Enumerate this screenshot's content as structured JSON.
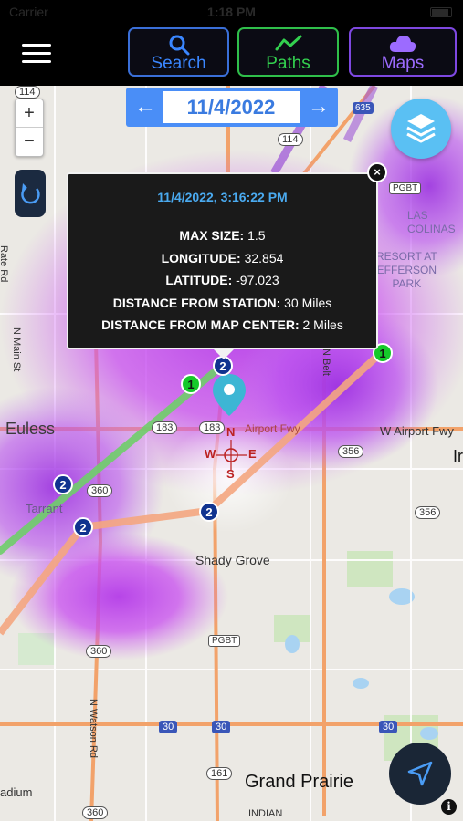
{
  "status": {
    "carrier": "Carrier",
    "time": "1:18 PM"
  },
  "header": {
    "menu_icon": "hamburger-menu-icon",
    "buttons": [
      {
        "label": "Search",
        "icon": "magnifier-icon",
        "color": "#3a86ff"
      },
      {
        "label": "Paths",
        "icon": "trend-line-icon",
        "color": "#33d14f"
      },
      {
        "label": "Maps",
        "icon": "cloud-icon",
        "color": "#9c6bff"
      }
    ]
  },
  "datebar": {
    "prev": "←",
    "date": "11/4/2022",
    "next": "→"
  },
  "zoom": {
    "in": "+",
    "out": "−"
  },
  "popup": {
    "title": "11/4/2022, 3:16:22 PM",
    "close": "×",
    "rows": [
      {
        "label": "MAX SIZE:",
        "value": "1.5"
      },
      {
        "label": "LONGITUDE:",
        "value": "32.854"
      },
      {
        "label": "LATITUDE:",
        "value": "-97.023"
      },
      {
        "label": "DISTANCE FROM STATION:",
        "value": "30 Miles"
      },
      {
        "label": "DISTANCE FROM MAP CENTER:",
        "value": "2 Miles"
      }
    ]
  },
  "map": {
    "labels": {
      "euless": "Euless",
      "shady_grove": "Shady Grove",
      "grand_prairie": "Grand Prairie",
      "las_colinas": "LAS\nCOLINAS",
      "resort": "RESORT AT\nEFFERSON\nPARK",
      "airport_fwy": "Airport Fwy",
      "w_airport_fwy": "W Airport Fwy",
      "n_main_st": "N Main St",
      "rate_rd": "Rate Rd",
      "n_watson_rd": "N Watson Rd",
      "n_belt": "N Belt",
      "tarrant": "Tarrant",
      "radium": "adium",
      "indian": "INDIAN",
      "ir": "Ir",
      "compass_n": "N",
      "compass_w": "W",
      "compass_e": "E",
      "compass_s": "S"
    },
    "shields": {
      "s114a": "114",
      "s114b": "114",
      "s183a": "183",
      "s183b": "183",
      "s360a": "360",
      "s360b": "360",
      "s360c": "360",
      "s356a": "356",
      "s356b": "356",
      "s161": "161",
      "i30a": "30",
      "i30b": "30",
      "i30c": "30",
      "i635": "635",
      "pgbt1": "PGBT",
      "pgbt2": "PGBT"
    },
    "markers": {
      "m2_top": "2",
      "m1_left": "1",
      "m1_right": "1",
      "m2_a": "2",
      "m2_b": "2",
      "m2_c": "2"
    },
    "accent_colors": {
      "storm": "#c84cf0",
      "path_green": "#6fcf6a",
      "path_orange": "#f4a680",
      "pin": "#3db6d4"
    }
  },
  "buttons": {
    "layers_icon": "layers-icon",
    "refresh_icon": "refresh-icon",
    "locate_icon": "navigation-arrow-icon",
    "info": "i"
  }
}
